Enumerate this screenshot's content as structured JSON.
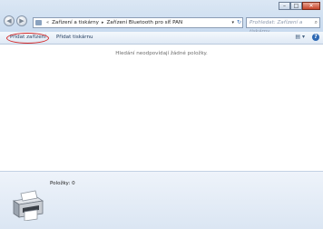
{
  "breadcrumb": {
    "items": [
      "Zařízení a tiskárny",
      "Zařízení Bluetooth pro síť PAN"
    ]
  },
  "search": {
    "placeholder": "Prohledat: Zařízení a tiskárny"
  },
  "toolbar": {
    "add_device_label": "Přidat zařízení",
    "add_printer_label": "Přidat tiskárnu"
  },
  "content": {
    "empty_message": "Hledání neodpovídají žádné položky."
  },
  "details": {
    "count_label": "Položky: 0"
  },
  "colors": {
    "highlight": "#d42a2a",
    "title_bar": "#dbe7f4",
    "close_button": "#c7452b"
  },
  "icons": {
    "back": "back-arrow-icon",
    "forward": "forward-arrow-icon",
    "folder": "devices-folder-icon",
    "refresh": "refresh-icon",
    "search": "search-icon",
    "view": "view-options-icon",
    "help": "help-icon",
    "printer": "printer-icon"
  }
}
